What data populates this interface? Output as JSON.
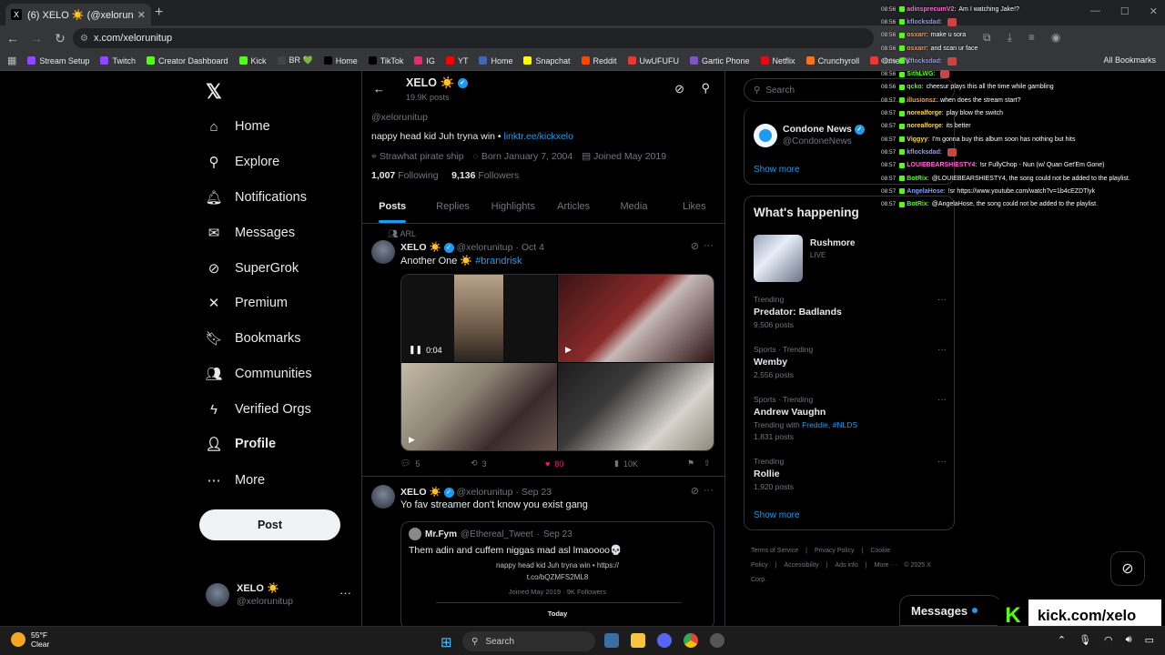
{
  "browser": {
    "tab_title": "(6) XELO ☀️ (@xelorunitup) / X",
    "url": "x.com/xelorunitup",
    "bookmarks": [
      {
        "label": "Stream Setup",
        "color": "#9146ff"
      },
      {
        "label": "Twitch",
        "color": "#9146ff"
      },
      {
        "label": "Creator Dashboard",
        "color": "#53fc18"
      },
      {
        "label": "Kick",
        "color": "#53fc18"
      },
      {
        "label": "BR 💚",
        "color": "#444444"
      },
      {
        "label": "Home",
        "color": "#000000"
      },
      {
        "label": "TikTok",
        "color": "#000000"
      },
      {
        "label": "IG",
        "color": "#e1306c"
      },
      {
        "label": "YT",
        "color": "#ff0000"
      },
      {
        "label": "Home",
        "color": "#4267b2"
      },
      {
        "label": "Snapchat",
        "color": "#fffc00"
      },
      {
        "label": "Reddit",
        "color": "#ff4500"
      },
      {
        "label": "UwUFUFU",
        "color": "#e53935"
      },
      {
        "label": "Gartic Phone",
        "color": "#7e57c2"
      },
      {
        "label": "Netflix",
        "color": "#e50914"
      },
      {
        "label": "Crunchyroll",
        "color": "#f47521"
      },
      {
        "label": "OmeTV",
        "color": "#e53935"
      }
    ],
    "all_bookmarks": "All Bookmarks"
  },
  "nav": {
    "items": [
      {
        "label": "Home",
        "icon": "home-icon",
        "glyph": "⌂"
      },
      {
        "label": "Explore",
        "icon": "search-icon",
        "glyph": "⚲"
      },
      {
        "label": "Notifications",
        "icon": "bell-icon",
        "glyph": "🔔︎",
        "badge": "1"
      },
      {
        "label": "Messages",
        "icon": "mail-icon",
        "glyph": "✉",
        "badge": "5"
      },
      {
        "label": "SuperGrok",
        "icon": "grok-icon",
        "glyph": "⊘"
      },
      {
        "label": "Premium",
        "icon": "x-icon",
        "glyph": "✕"
      },
      {
        "label": "Bookmarks",
        "icon": "bookmark-icon",
        "glyph": "🔖︎"
      },
      {
        "label": "Communities",
        "icon": "communities-icon",
        "glyph": "👥︎"
      },
      {
        "label": "Verified Orgs",
        "icon": "lightning-icon",
        "glyph": "ϟ"
      },
      {
        "label": "Profile",
        "icon": "person-icon",
        "glyph": "👤︎"
      },
      {
        "label": "More",
        "icon": "more-circle-icon",
        "glyph": "⋯"
      }
    ],
    "post_label": "Post",
    "account": {
      "display_name": "XELO ☀️",
      "handle": "@xelorunitup"
    }
  },
  "profile": {
    "name": "XELO ☀️",
    "post_count": "19.9K posts",
    "handle": "@xelorunitup",
    "bio_text": "nappy head kid Juh tryna win • ",
    "bio_link": "linktr.ee/kickxelo",
    "location": "Strawhat pirate ship",
    "born": "Born January 7, 2004",
    "joined": "Joined May 2019",
    "following_count": "1,007",
    "following_label": "Following",
    "followers_count": "9,136",
    "followers_label": "Followers",
    "tabs": [
      "Posts",
      "Replies",
      "Highlights",
      "Articles",
      "Media",
      "Likes"
    ],
    "active_tab": "Posts"
  },
  "tweet1": {
    "repost_label": "ARL",
    "name": "XELO ☀️",
    "handle": "@xelorunitup",
    "date": "Oct 4",
    "text": "Another One ☀️ ",
    "hashtag": "#brandrisk",
    "video_time": "0:04",
    "replies": "5",
    "reposts": "3",
    "likes": "80",
    "views": "10K"
  },
  "tweet2": {
    "name": "XELO ☀️",
    "handle": "@xelorunitup",
    "date": "Sep 23",
    "text": "Yo fav streamer don't know you exist gang",
    "quote": {
      "name": "Mr.Fym",
      "handle": "@Ethereal_Tweet",
      "date": "Sep 23",
      "text": "Them adin and cuffem niggas mad asl lmaoooo💀",
      "inner_bio": "nappy head kid Juh tryna win • https://",
      "inner_link": "t.co/bQZMFS2ML8",
      "inner_joined": "Joined May 2019 · 9K Followers",
      "today": "Today"
    }
  },
  "right": {
    "search_placeholder": "Search",
    "follow_name": "Condone News",
    "follow_handle": "@CondoneNews",
    "follow_show_more": "Show more",
    "happening_title": "What's happening",
    "live_name": "Rushmore",
    "live_tag": "LIVE",
    "trends": [
      {
        "category": "Trending",
        "name": "Predator: Badlands",
        "count": "9,506 posts"
      },
      {
        "category": "Sports · Trending",
        "name": "Wemby",
        "count": "2,556 posts"
      },
      {
        "category": "Sports · Trending",
        "name": "Andrew Vaughn",
        "with_prefix": "Trending with ",
        "with": "Freddie, #NLDS",
        "count": "1,831 posts"
      },
      {
        "category": "Trending",
        "name": "Rollie",
        "count": "1,920 posts"
      }
    ],
    "show_more": "Show more",
    "footer": [
      "Terms of Service",
      "|",
      "Privacy Policy",
      "|",
      "Cookie Policy",
      "|",
      "Accessibility",
      "|",
      "Ads info",
      "|",
      "More ···",
      "© 2025 X Corp."
    ]
  },
  "chat": [
    {
      "time": "08:56",
      "user": "adinsprecumV2",
      "color": "#ff6ad5",
      "msg": "Am I watching Jake!?"
    },
    {
      "time": "08:56",
      "user": "kflocksdad",
      "color": "#8a9bff",
      "msg": "",
      "emote": true
    },
    {
      "time": "08:56",
      "user": "osxarr",
      "color": "#ff9a3c",
      "msg": "make u sora"
    },
    {
      "time": "08:56",
      "user": "osxarr",
      "color": "#ff9a3c",
      "msg": "and scan ur face"
    },
    {
      "time": "08:56",
      "user": "kflocksdad",
      "color": "#8a9bff",
      "msg": "",
      "emote": true
    },
    {
      "time": "08:56",
      "user": "SithLWG",
      "color": "#53fc18",
      "msg": "",
      "emote": true
    },
    {
      "time": "08:56",
      "user": "qcko",
      "color": "#53fc18",
      "msg": "cheesur plays this all the time while gambling"
    },
    {
      "time": "08:57",
      "user": "illusionsz",
      "color": "#ff9a3c",
      "msg": "when does the stream start?"
    },
    {
      "time": "08:57",
      "user": "norealforge",
      "color": "#ffd84d",
      "msg": "play blow the switch"
    },
    {
      "time": "08:57",
      "user": "norealforge",
      "color": "#ffd84d",
      "msg": "its better"
    },
    {
      "time": "08:57",
      "user": "Viggyy",
      "color": "#ffd84d",
      "msg": "I'm gonna buy this album soon has nothing but hits"
    },
    {
      "time": "08:57",
      "user": "kflocksdad",
      "color": "#8a9bff",
      "msg": "",
      "emote": true
    },
    {
      "time": "08:57",
      "user": "LOUIEBEARSHIESTY4",
      "color": "#ff6ad5",
      "msg": "!sr FullyChop - Nun (w/ Quan Get'Em Gone)"
    },
    {
      "time": "08:57",
      "user": "BotRix",
      "color": "#53fc18",
      "msg": "@LOUIEBEARSHIESTY4, the song could not be added to the playlist."
    },
    {
      "time": "08:57",
      "user": "AngelaHose",
      "color": "#8a9bff",
      "msg": "!sr https://www.youtube.com/watch?v=1b4cEZDTlyk"
    },
    {
      "time": "08:57",
      "user": "BotRix",
      "color": "#53fc18",
      "msg": "@AngelaHose, the song could not be added to the playlist."
    }
  ],
  "overlay": {
    "messages_label": "Messages",
    "kick_logo": "K",
    "kick_url": "kick.com/xelo"
  },
  "taskbar": {
    "temp": "55°F",
    "condition": "Clear",
    "search_label": "Search"
  }
}
